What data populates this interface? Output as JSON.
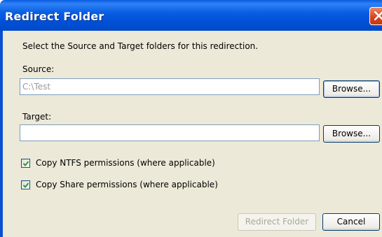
{
  "window": {
    "title": "Redirect Folder"
  },
  "instructions": "Select the Source and Target folders for this redirection.",
  "source": {
    "label": "Source:",
    "value": "C:\\Test",
    "browse_label": "Browse..."
  },
  "target": {
    "label": "Target:",
    "value": "",
    "browse_label": "Browse..."
  },
  "options": [
    {
      "label": "Copy NTFS permissions (where applicable)",
      "checked": true
    },
    {
      "label": "Copy Share permissions (where applicable)",
      "checked": true
    }
  ],
  "buttons": {
    "redirect_label": "Redirect Folder",
    "cancel_label": "Cancel"
  },
  "colors": {
    "titlebar": "#0050d8",
    "dialog_bg": "#ece9d8",
    "checkmark": "#21a121"
  }
}
